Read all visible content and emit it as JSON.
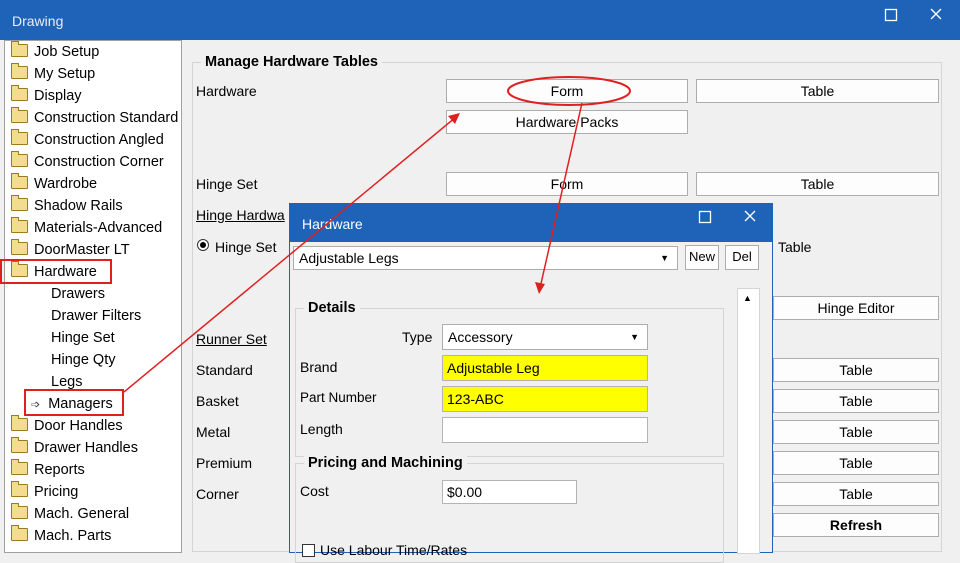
{
  "window": {
    "title": "Drawing",
    "maximize_icon": "maximize-icon",
    "close_icon": "close-icon"
  },
  "tree": {
    "items": [
      {
        "label": "Job Setup"
      },
      {
        "label": "My Setup"
      },
      {
        "label": "Display"
      },
      {
        "label": "Construction Standard"
      },
      {
        "label": "Construction Angled"
      },
      {
        "label": "Construction Corner"
      },
      {
        "label": "Wardrobe"
      },
      {
        "label": "Shadow Rails"
      },
      {
        "label": "Materials-Advanced"
      },
      {
        "label": "DoorMaster LT"
      },
      {
        "label": "Hardware"
      },
      {
        "label": "Drawers"
      },
      {
        "label": "Drawer Filters"
      },
      {
        "label": "Hinge Set"
      },
      {
        "label": "Hinge Qty"
      },
      {
        "label": "Legs"
      },
      {
        "label": "Managers"
      },
      {
        "label": "Door Handles"
      },
      {
        "label": "Drawer Handles"
      },
      {
        "label": "Reports"
      },
      {
        "label": "Pricing"
      },
      {
        "label": "Mach. General"
      },
      {
        "label": "Mach. Parts"
      }
    ],
    "arrow_glyph": "➩"
  },
  "manage": {
    "title": "Manage Hardware Tables",
    "hardware_label": "Hardware",
    "form_btn": "Form",
    "table_btn": "Table",
    "hardware_packs_btn": "Hardware Packs",
    "hinge_set_label": "Hinge Set",
    "hinge_form_btn": "Form",
    "hinge_table_btn": "Table",
    "hinge_hardware_label": "Hinge Hardwa",
    "hinge_set_radio": "Hinge Set",
    "table_label_right": "Table",
    "hinge_editor_btn": "Hinge Editor",
    "runner_set_label": "Runner Set",
    "runner_rows": [
      {
        "label": "Standard",
        "btn": "Table"
      },
      {
        "label": "Basket",
        "btn": "Table"
      },
      {
        "label": "Metal",
        "btn": "Table"
      },
      {
        "label": "Premium",
        "btn": "Table"
      },
      {
        "label": "Corner",
        "btn": "Table"
      }
    ],
    "refresh_btn": "Refresh"
  },
  "dialog": {
    "title": "Hardware",
    "selected": "Adjustable Legs",
    "new_btn": "New",
    "del_btn": "Del",
    "details_title": "Details",
    "type_label": "Type",
    "type_value": "Accessory",
    "brand_label": "Brand",
    "brand_value": "Adjustable Leg",
    "part_label": "Part Number",
    "part_value": "123-ABC",
    "length_label": "Length",
    "length_value": "",
    "pricing_title": "Pricing and Machining",
    "cost_label": "Cost",
    "cost_value": "$0.00",
    "labour_label": "Use Labour Time/Rates"
  },
  "colors": {
    "accent": "#1e63b8",
    "highlight": "#ffff00",
    "annotation": "#e02020"
  }
}
